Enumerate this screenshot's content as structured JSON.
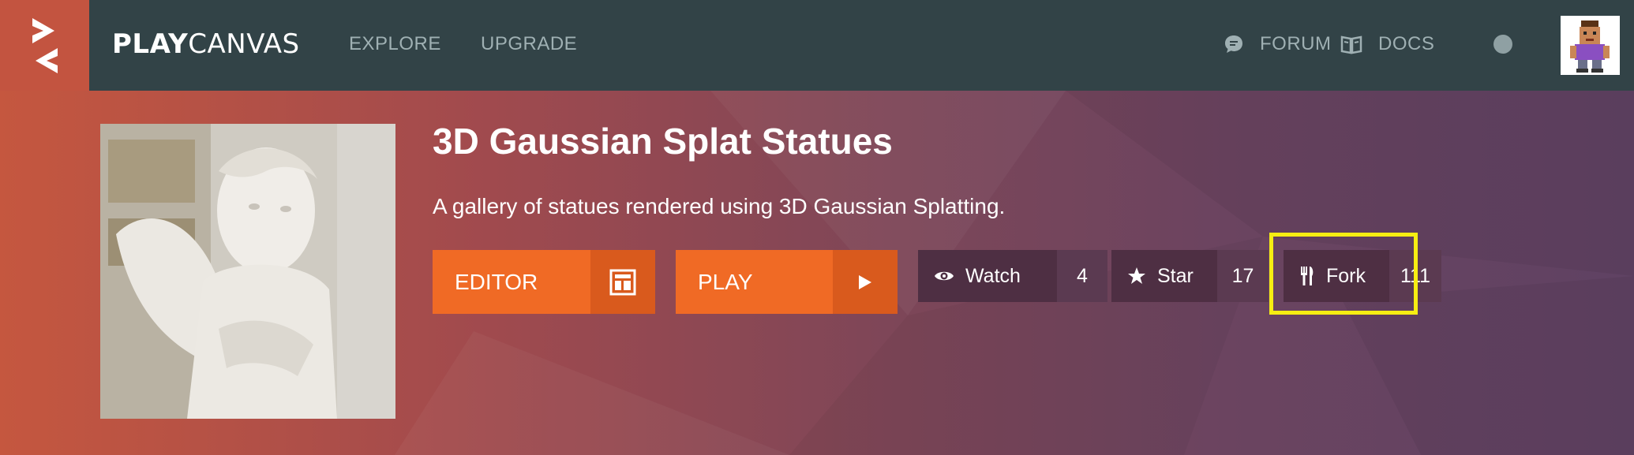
{
  "nav": {
    "brand_bold": "PLAY",
    "brand_light": "CANVAS",
    "explore": "EXPLORE",
    "upgrade": "UPGRADE",
    "forum": "FORUM",
    "docs": "DOCS"
  },
  "project": {
    "title": "3D Gaussian Splat Statues",
    "description": "A gallery of statues rendered using 3D Gaussian Splatting."
  },
  "actions": {
    "editor_label": "EDITOR",
    "play_label": "PLAY",
    "watch_label": "Watch",
    "watch_count": "4",
    "star_label": "Star",
    "star_count": "17",
    "fork_label": "Fork",
    "fork_count": "111"
  },
  "colors": {
    "accent_orange": "#f06a25",
    "nav_bg": "#324347",
    "highlight": "#f6ee12"
  },
  "icons": [
    "playcanvas-logo-icon",
    "chat-bubble-icon",
    "book-icon",
    "layout-icon",
    "play-icon",
    "eye-icon",
    "star-icon",
    "fork-knife-icon"
  ]
}
